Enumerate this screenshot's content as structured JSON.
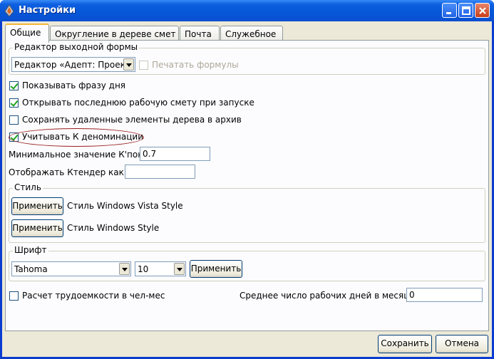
{
  "window": {
    "title": "Настройки",
    "icon": "app-diamond-icon"
  },
  "tabs": [
    {
      "label": "Общие",
      "active": true
    },
    {
      "label": "Округление в дереве смет",
      "active": false
    },
    {
      "label": "Почта",
      "active": false
    },
    {
      "label": "Служебное",
      "active": false
    }
  ],
  "output_form_group": {
    "label": "Редактор выходной формы",
    "editor_select_value": "Редактор «Адепт: Проект»",
    "print_formulas_label": "Печатать формулы",
    "print_formulas_checked": false,
    "print_formulas_enabled": false
  },
  "options": [
    {
      "label": "Показывать фразу дня",
      "checked": true
    },
    {
      "label": "Открывать последнюю рабочую смету при запуске",
      "checked": true
    },
    {
      "label": "Сохранять удаленные элементы дерева в архив",
      "checked": false
    },
    {
      "label": "Учитывать К деноминации",
      "checked": true
    }
  ],
  "min_kpon": {
    "label": "Минимальное значение К'пон:",
    "value": "0.7"
  },
  "ktender": {
    "label": "Отображать Ктендер как К",
    "value": ""
  },
  "style_group": {
    "label": "Стиль",
    "rows": [
      {
        "button": "Применить",
        "text": "Стиль Windows Vista Style"
      },
      {
        "button": "Применить",
        "text": "Стиль Windows Style"
      }
    ]
  },
  "font_group": {
    "label": "Шрифт",
    "font_name": "Tahoma",
    "font_size": "10",
    "apply_button": "Применить"
  },
  "labor_checkbox": {
    "label": "Расчет трудоемкости в чел-мес",
    "checked": false
  },
  "work_days": {
    "label": "Среднее число рабочих дней в месяце",
    "value": "0"
  },
  "footer": {
    "save_button": "Сохранить",
    "cancel_button": "Отмена"
  },
  "colors": {
    "titlebar": "#0656d8",
    "annotation_oval": "#9b1c1c",
    "checkmark": "#21a121"
  }
}
